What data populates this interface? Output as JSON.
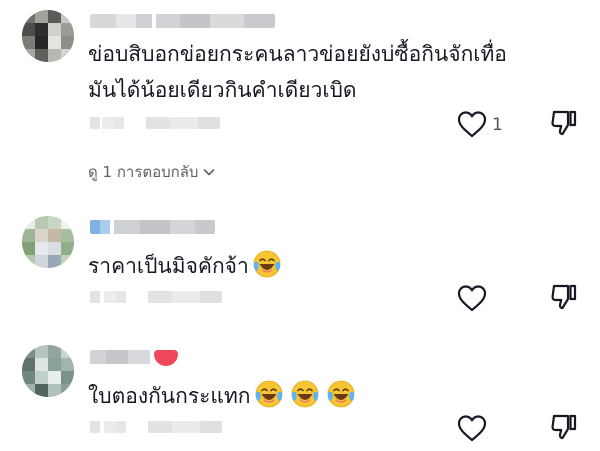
{
  "comments": [
    {
      "text_line1": "ข่อบสิบอกข่อยกระคนลาวข่อยยังบ่ซื้อกินจักเทื่อ",
      "text_line2": "มันได้น้อยเดียวกินคำเดียวเบิด",
      "like_count": "1",
      "view_replies": "ดู 1 การตอบกลับ"
    },
    {
      "text": "ราคาเป็นมิจคักจ้า",
      "like_count": ""
    },
    {
      "text": "ใบตองกันกระแทก",
      "like_count": ""
    }
  ],
  "colors": {
    "text": "#161823",
    "muted": "#5f6066",
    "icon": "#161823",
    "heart_badge": "#f0485a"
  },
  "icons": [
    "heart-outline-icon",
    "thumbs-down-icon",
    "chevron-down-icon",
    "laughing-tears-emoji"
  ]
}
